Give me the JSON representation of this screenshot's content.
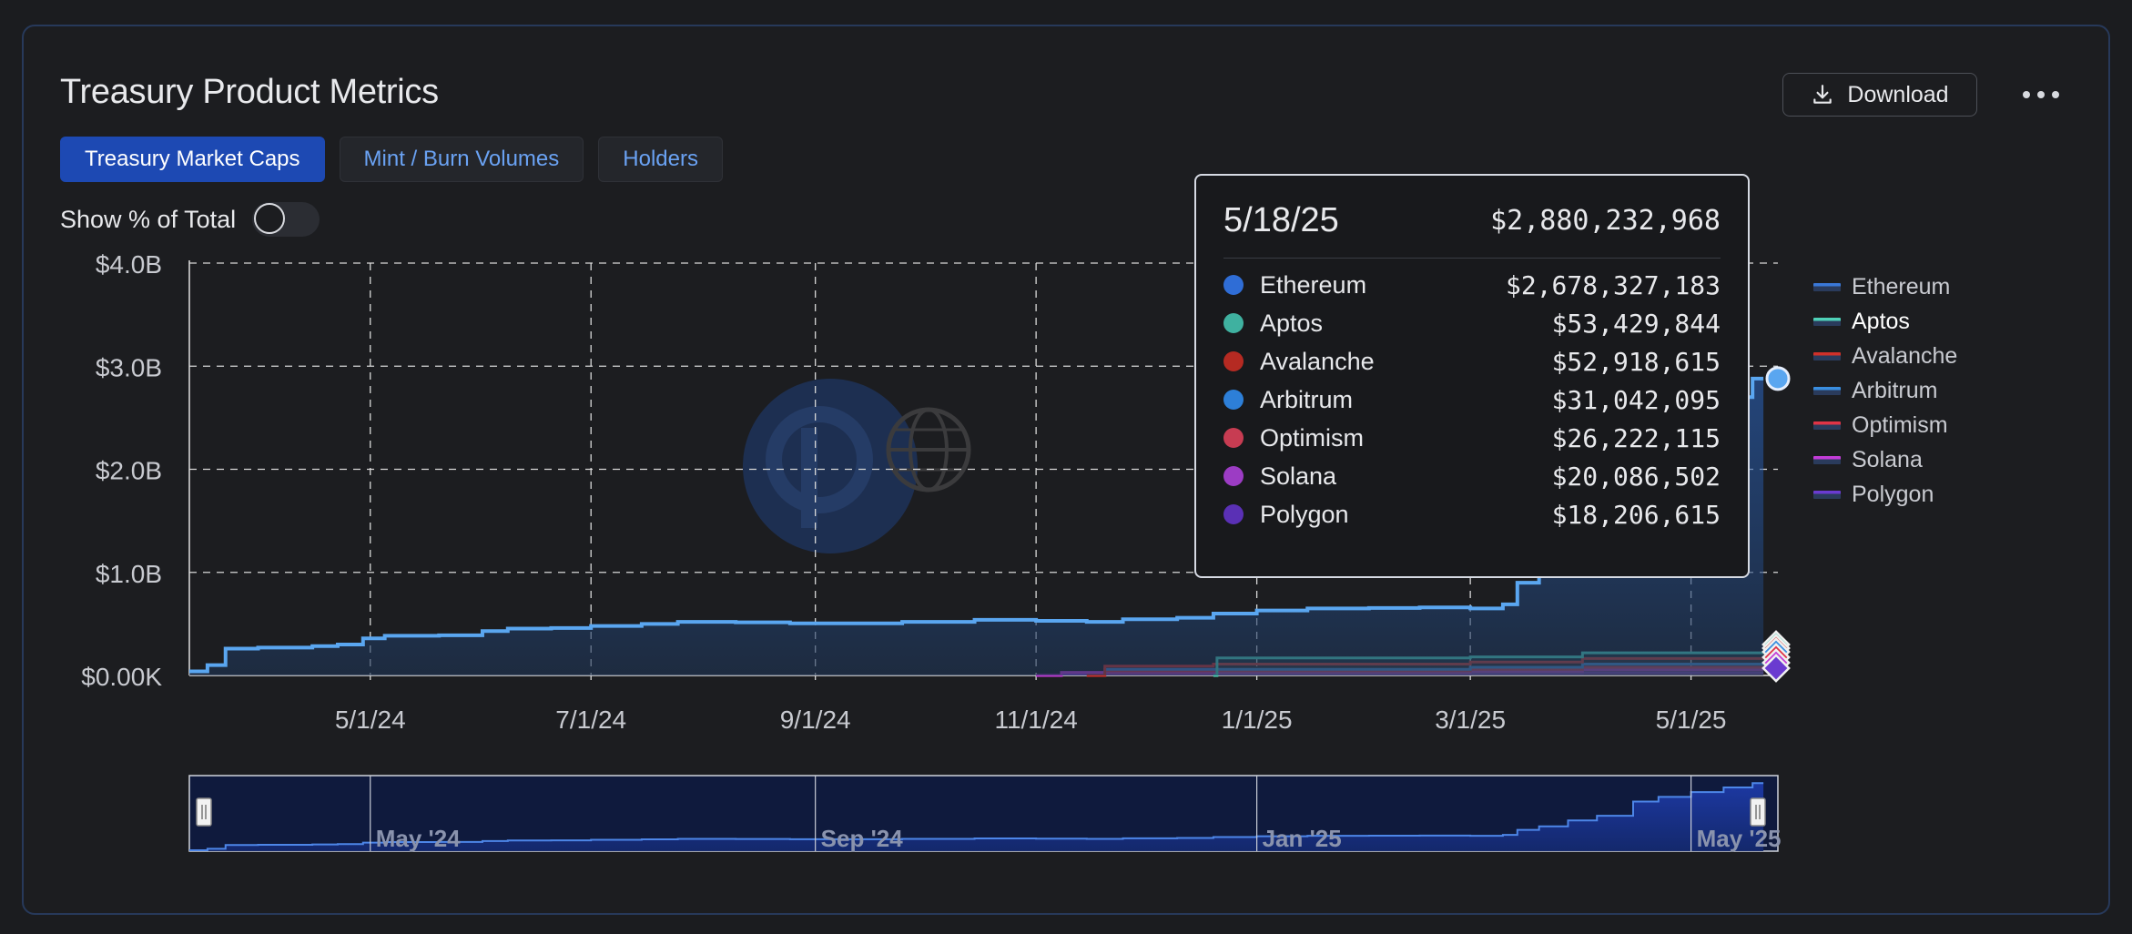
{
  "title": "Treasury Product Metrics",
  "download_label": "Download",
  "more_icon": "more-horizontal-icon",
  "download_icon": "download-icon",
  "tabs": [
    {
      "label": "Treasury Market Caps",
      "active": true
    },
    {
      "label": "Mint / Burn Volumes",
      "active": false
    },
    {
      "label": "Holders",
      "active": false
    }
  ],
  "toggle": {
    "label": "Show % of Total",
    "on": false
  },
  "tooltip": {
    "date": "5/18/25",
    "total": "$2,880,232,968",
    "rows": [
      {
        "name": "Ethereum",
        "value": "$2,678,327,183",
        "color": "#2f6dd6"
      },
      {
        "name": "Aptos",
        "value": "$53,429,844",
        "color": "#3fb1a0"
      },
      {
        "name": "Avalanche",
        "value": "$52,918,615",
        "color": "#b52a22"
      },
      {
        "name": "Arbitrum",
        "value": "$31,042,095",
        "color": "#2d7fd8"
      },
      {
        "name": "Optimism",
        "value": "$26,222,115",
        "color": "#c73c52"
      },
      {
        "name": "Solana",
        "value": "$20,086,502",
        "color": "#9c3cc4"
      },
      {
        "name": "Polygon",
        "value": "$18,206,615",
        "color": "#5a30b5"
      }
    ]
  },
  "legend": [
    {
      "name": "Ethereum",
      "color": "#3a78d8",
      "highlight": false
    },
    {
      "name": "Aptos",
      "color": "#4fd1b8",
      "highlight": true
    },
    {
      "name": "Avalanche",
      "color": "#d0312a",
      "highlight": false
    },
    {
      "name": "Arbitrum",
      "color": "#3a8ee0",
      "highlight": false
    },
    {
      "name": "Optimism",
      "color": "#e03446",
      "highlight": false
    },
    {
      "name": "Solana",
      "color": "#c43cd8",
      "highlight": false
    },
    {
      "name": "Polygon",
      "color": "#6a3bd0",
      "highlight": false
    }
  ],
  "chart_data": {
    "type": "area",
    "title": "Treasury Product Metrics",
    "ylabel": "",
    "xlabel": "",
    "ylim": [
      0,
      4000000000
    ],
    "xlim": [
      "2024-03-12",
      "2025-05-25"
    ],
    "yticks": [
      {
        "value": 0,
        "label": "$0.00K"
      },
      {
        "value": 1000000000,
        "label": "$1.0B"
      },
      {
        "value": 2000000000,
        "label": "$2.0B"
      },
      {
        "value": 3000000000,
        "label": "$3.0B"
      },
      {
        "value": 4000000000,
        "label": "$4.0B"
      }
    ],
    "xticks": [
      {
        "date": "2024-05-01",
        "label": "5/1/24"
      },
      {
        "date": "2024-07-01",
        "label": "7/1/24"
      },
      {
        "date": "2024-09-01",
        "label": "9/1/24"
      },
      {
        "date": "2024-11-01",
        "label": "11/1/24"
      },
      {
        "date": "2025-01-01",
        "label": "1/1/25"
      },
      {
        "date": "2025-03-01",
        "label": "3/1/25"
      },
      {
        "date": "2025-05-01",
        "label": "5/1/25"
      }
    ],
    "grid": true,
    "legend_position": "right",
    "series": [
      {
        "name": "Ethereum",
        "color": "#5aa6f0",
        "points": [
          [
            "2024-03-12",
            40000000
          ],
          [
            "2024-03-17",
            100000000
          ],
          [
            "2024-03-22",
            260000000
          ],
          [
            "2024-03-31",
            270000000
          ],
          [
            "2024-04-15",
            285000000
          ],
          [
            "2024-04-22",
            300000000
          ],
          [
            "2024-04-29",
            360000000
          ],
          [
            "2024-05-05",
            385000000
          ],
          [
            "2024-05-20",
            390000000
          ],
          [
            "2024-06-01",
            430000000
          ],
          [
            "2024-06-08",
            455000000
          ],
          [
            "2024-06-20",
            460000000
          ],
          [
            "2024-07-01",
            480000000
          ],
          [
            "2024-07-15",
            500000000
          ],
          [
            "2024-07-25",
            520000000
          ],
          [
            "2024-08-10",
            515000000
          ],
          [
            "2024-08-25",
            505000000
          ],
          [
            "2024-09-10",
            505000000
          ],
          [
            "2024-09-25",
            520000000
          ],
          [
            "2024-10-05",
            520000000
          ],
          [
            "2024-10-15",
            540000000
          ],
          [
            "2024-11-01",
            530000000
          ],
          [
            "2024-11-15",
            520000000
          ],
          [
            "2024-11-25",
            545000000
          ],
          [
            "2024-12-10",
            560000000
          ],
          [
            "2024-12-20",
            600000000
          ],
          [
            "2025-01-01",
            630000000
          ],
          [
            "2025-01-15",
            650000000
          ],
          [
            "2025-02-01",
            655000000
          ],
          [
            "2025-02-15",
            660000000
          ],
          [
            "2025-03-01",
            650000000
          ],
          [
            "2025-03-10",
            690000000
          ],
          [
            "2025-03-14",
            900000000
          ],
          [
            "2025-03-20",
            1050000000
          ],
          [
            "2025-03-28",
            1300000000
          ],
          [
            "2025-04-05",
            1500000000
          ],
          [
            "2025-04-15",
            2100000000
          ],
          [
            "2025-04-22",
            2300000000
          ],
          [
            "2025-05-01",
            2500000000
          ],
          [
            "2025-05-10",
            2700000000
          ],
          [
            "2025-05-18",
            2880232968
          ],
          [
            "2025-05-21",
            2880232968
          ]
        ]
      },
      {
        "name": "Aptos",
        "color": "#4fd1b8",
        "points": [
          [
            "2024-12-20",
            0
          ],
          [
            "2024-12-21",
            170000000
          ],
          [
            "2025-03-01",
            180000000
          ],
          [
            "2025-04-01",
            220000000
          ],
          [
            "2025-05-21",
            220000000
          ]
        ]
      },
      {
        "name": "Avalanche",
        "color": "#d0312a",
        "points": [
          [
            "2024-11-15",
            0
          ],
          [
            "2024-11-20",
            90000000
          ],
          [
            "2024-12-20",
            110000000
          ],
          [
            "2025-03-01",
            130000000
          ],
          [
            "2025-04-01",
            165000000
          ],
          [
            "2025-05-21",
            165000000
          ]
        ]
      },
      {
        "name": "Arbitrum",
        "color": "#3a8ee0",
        "points": [
          [
            "2024-11-15",
            0
          ],
          [
            "2024-11-20",
            60000000
          ],
          [
            "2025-03-01",
            80000000
          ],
          [
            "2025-04-01",
            110000000
          ],
          [
            "2025-05-21",
            110000000
          ]
        ]
      },
      {
        "name": "Optimism",
        "color": "#e03446",
        "points": [
          [
            "2024-11-15",
            0
          ],
          [
            "2024-11-20",
            45000000
          ],
          [
            "2025-03-01",
            60000000
          ],
          [
            "2025-04-01",
            80000000
          ],
          [
            "2025-05-21",
            80000000
          ]
        ]
      },
      {
        "name": "Solana",
        "color": "#c43cd8",
        "points": [
          [
            "2024-11-01",
            0
          ],
          [
            "2024-11-08",
            30000000
          ],
          [
            "2025-03-01",
            40000000
          ],
          [
            "2025-04-01",
            55000000
          ],
          [
            "2025-05-21",
            55000000
          ]
        ]
      },
      {
        "name": "Polygon",
        "color": "#6a3bd0",
        "points": [
          [
            "2024-11-01",
            0
          ],
          [
            "2024-11-08",
            15000000
          ],
          [
            "2025-03-01",
            20000000
          ],
          [
            "2025-04-01",
            25000000
          ],
          [
            "2025-05-21",
            25000000
          ]
        ]
      }
    ],
    "navigator": {
      "labels": [
        "May '24",
        "Sep '24",
        "Jan '25",
        "May '25"
      ],
      "range": [
        "2024-03-12",
        "2025-05-25"
      ]
    },
    "hover_date": "2025-05-18"
  }
}
